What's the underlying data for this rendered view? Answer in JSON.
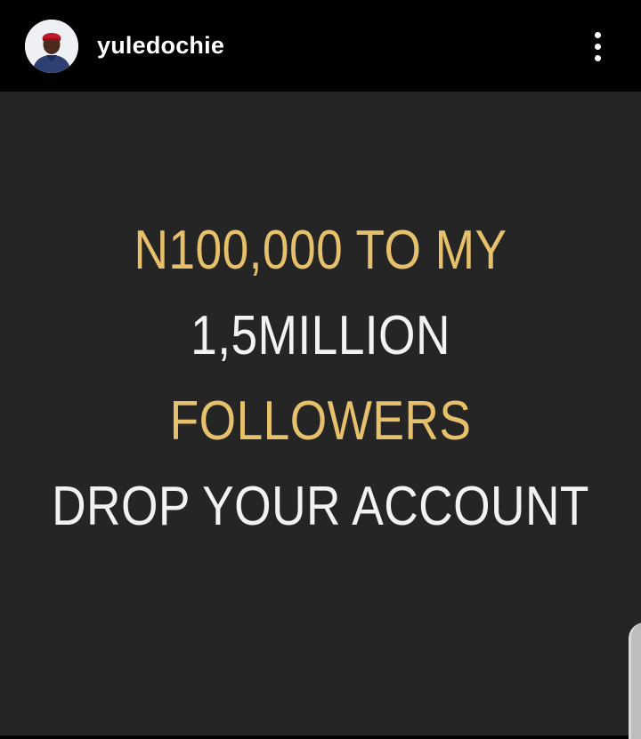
{
  "header": {
    "username": "yuledochie",
    "avatar_icon": "profile-avatar",
    "more_icon": "vertical-ellipsis-icon"
  },
  "post": {
    "background_color": "#252525",
    "lines": [
      {
        "text": "N100,000 TO MY",
        "color": "#e6c06a"
      },
      {
        "text": "1,5MILLION",
        "color": "#f2f2f2"
      },
      {
        "text": "FOLLOWERS",
        "color": "#e6c06a"
      },
      {
        "text": "DROP YOUR ACCOUNT",
        "color": "#f2f2f2"
      }
    ]
  },
  "colors": {
    "header_bg": "#000000",
    "username": "#ffffff",
    "gold_text": "#e6c06a",
    "white_text": "#f2f2f2"
  }
}
